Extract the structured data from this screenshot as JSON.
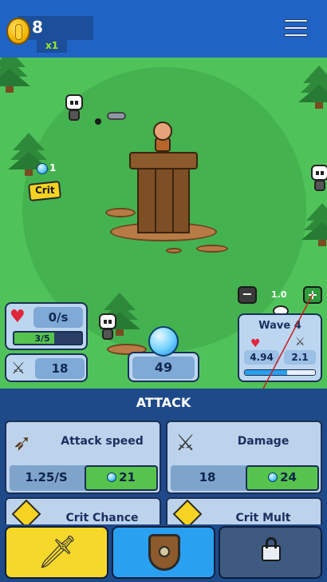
{
  "hud": {
    "coins": "8",
    "multiplier": "x1"
  },
  "zoom": {
    "minus_label": "−",
    "plus_label": "+",
    "value": "1.0"
  },
  "effects": {
    "gem_pickup": "1",
    "crit_text": "Crit"
  },
  "stats": {
    "regen": "0/s",
    "health": "3/5",
    "health_fraction": 0.6,
    "attack_power": "18",
    "gems": "49"
  },
  "wave": {
    "title": "Wave 4",
    "enemy_health": "4.94",
    "enemy_damage": "2.1",
    "progress_fraction": 0.6
  },
  "upgrades": {
    "section_title": "ATTACK",
    "items": [
      {
        "label": "Attack speed",
        "value": "1.25/S",
        "cost": "21",
        "icon": "bow-icon"
      },
      {
        "label": "Damage",
        "value": "18",
        "cost": "24",
        "icon": "crossed-swords-icon"
      },
      {
        "label": "Crit Chance",
        "icon": "crit-burst-icon"
      },
      {
        "label": "Crit Mult",
        "icon": "crit-burst-icon"
      }
    ]
  },
  "tabs": [
    {
      "name": "attack",
      "icon": "sword-icon",
      "active": true
    },
    {
      "name": "defense",
      "icon": "shield-icon",
      "active": false
    },
    {
      "name": "locked",
      "icon": "lock-icon",
      "active": false
    }
  ],
  "colors": {
    "field": "#4fc35a",
    "topbar": "#1f63c4",
    "buy_button": "#56c44c",
    "tab_attack": "#f5d82a",
    "tab_defense": "#2aa0f0"
  }
}
